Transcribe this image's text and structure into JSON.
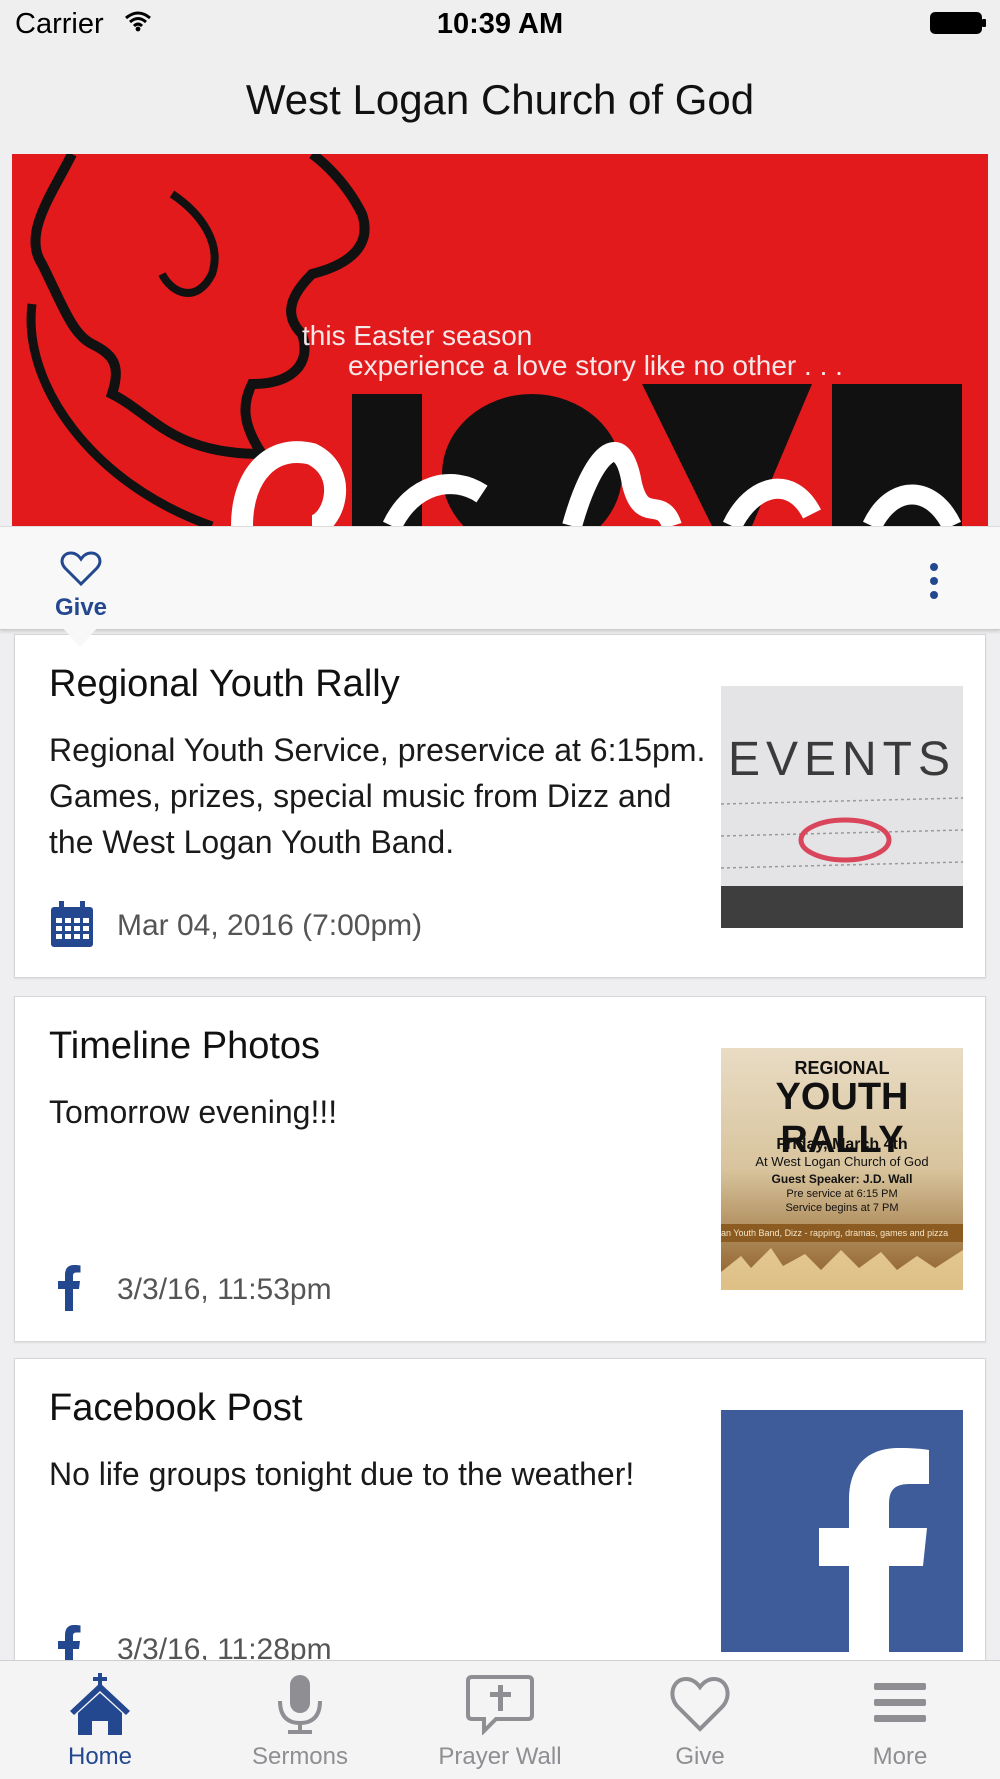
{
  "status_bar": {
    "carrier": "Carrier",
    "time": "10:39 AM"
  },
  "nav": {
    "title": "West Logan Church of God"
  },
  "hero": {
    "line1": "this Easter season",
    "line2": "experience a love story like no other . . ."
  },
  "action_bar": {
    "give_label": "Give"
  },
  "feed": [
    {
      "title": "Regional Youth Rally",
      "body": "Regional Youth Service, preservice at 6:15pm. Games, prizes, special music from Dizz and the West Logan Youth Band.",
      "meta": "Mar 04, 2016 (7:00pm)",
      "meta_icon": "calendar-icon",
      "thumb_text": "EVENTS"
    },
    {
      "title": "Timeline Photos",
      "body": "Tomorrow evening!!!",
      "meta": "3/3/16, 11:53pm",
      "meta_icon": "facebook-icon",
      "thumb": {
        "l1": "REGIONAL",
        "l2": "YOUTH RALLY",
        "l3": "Friday, March 4th",
        "l4": "At West Logan Church of God",
        "l5": "Guest Speaker: J.D. Wall",
        "l6": "Pre service at 6:15 PM",
        "l7": "Service begins at 7 PM",
        "l8": "an Youth Band, Dizz - rapping, dramas, games and pizza"
      }
    },
    {
      "title": "Facebook Post",
      "body": "No life groups tonight due to the weather!",
      "meta": "3/3/16, 11:28pm",
      "meta_icon": "facebook-icon",
      "thumb_icon": "facebook-logo"
    }
  ],
  "tabs": [
    {
      "label": "Home",
      "icon": "church-icon",
      "active": true
    },
    {
      "label": "Sermons",
      "icon": "microphone-icon"
    },
    {
      "label": "Prayer Wall",
      "icon": "prayer-wall-icon"
    },
    {
      "label": "Give",
      "icon": "heart-icon"
    },
    {
      "label": "More",
      "icon": "menu-icon"
    }
  ],
  "colors": {
    "accent": "#24488f",
    "hero_red": "#e31a1c",
    "facebook_blue": "#3b5998"
  }
}
